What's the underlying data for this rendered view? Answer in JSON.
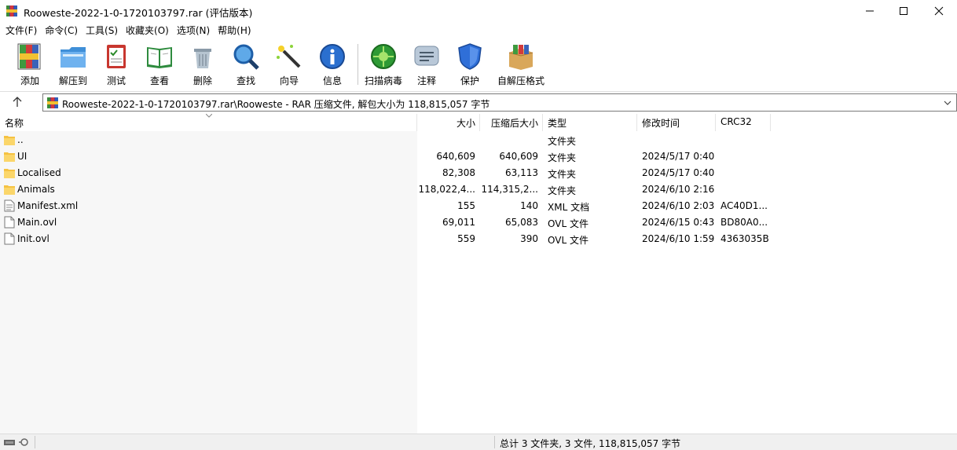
{
  "window": {
    "title": "Rooweste-2022-1-0-1720103797.rar (评估版本)",
    "minimize_icon": "minimize-icon",
    "maximize_icon": "maximize-icon",
    "close_icon": "close-icon"
  },
  "menu": [
    "文件(F)",
    "命令(C)",
    "工具(S)",
    "收藏夹(O)",
    "选项(N)",
    "帮助(H)"
  ],
  "toolbar": [
    {
      "label": "添加",
      "icon": "add-archive-icon"
    },
    {
      "label": "解压到",
      "icon": "extract-folder-icon"
    },
    {
      "label": "测试",
      "icon": "test-clipboard-icon"
    },
    {
      "label": "查看",
      "icon": "view-book-icon"
    },
    {
      "label": "删除",
      "icon": "delete-trash-icon"
    },
    {
      "label": "查找",
      "icon": "find-magnifier-icon"
    },
    {
      "label": "向导",
      "icon": "wizard-wand-icon"
    },
    {
      "label": "信息",
      "icon": "info-icon"
    },
    {
      "label": "扫描病毒",
      "icon": "virus-scan-icon"
    },
    {
      "label": "注释",
      "icon": "comment-icon"
    },
    {
      "label": "保护",
      "icon": "protect-shield-icon"
    },
    {
      "label": "自解压格式",
      "icon": "sfx-box-icon"
    }
  ],
  "address": {
    "path": "Rooweste-2022-1-0-1720103797.rar\\Rooweste - RAR 压缩文件, 解包大小为 118,815,057 字节"
  },
  "columns": {
    "name": "名称",
    "size": "大小",
    "packed": "压缩后大小",
    "type": "类型",
    "modified": "修改时间",
    "crc": "CRC32"
  },
  "files": [
    {
      "name": "..",
      "size": "",
      "packed": "",
      "type": "文件夹",
      "modified": "",
      "crc": "",
      "kind": "folder"
    },
    {
      "name": "UI",
      "size": "640,609",
      "packed": "640,609",
      "type": "文件夹",
      "modified": "2024/5/17 0:40",
      "crc": "",
      "kind": "folder"
    },
    {
      "name": "Localised",
      "size": "82,308",
      "packed": "63,113",
      "type": "文件夹",
      "modified": "2024/5/17 0:40",
      "crc": "",
      "kind": "folder"
    },
    {
      "name": "Animals",
      "size": "118,022,4...",
      "packed": "114,315,2...",
      "type": "文件夹",
      "modified": "2024/6/10 2:16",
      "crc": "",
      "kind": "folder"
    },
    {
      "name": "Manifest.xml",
      "size": "155",
      "packed": "140",
      "type": "XML 文档",
      "modified": "2024/6/10 2:03",
      "crc": "AC40D1...",
      "kind": "xml"
    },
    {
      "name": "Main.ovl",
      "size": "69,011",
      "packed": "65,083",
      "type": "OVL 文件",
      "modified": "2024/6/15 0:43",
      "crc": "BD80A0...",
      "kind": "file"
    },
    {
      "name": "Init.ovl",
      "size": "559",
      "packed": "390",
      "type": "OVL 文件",
      "modified": "2024/6/10 1:59",
      "crc": "4363035B",
      "kind": "file"
    }
  ],
  "status": {
    "summary": "总计 3 文件夹, 3 文件, 118,815,057 字节"
  },
  "colors": {
    "folder": "#f5c242",
    "accent": "#0a64c8"
  }
}
